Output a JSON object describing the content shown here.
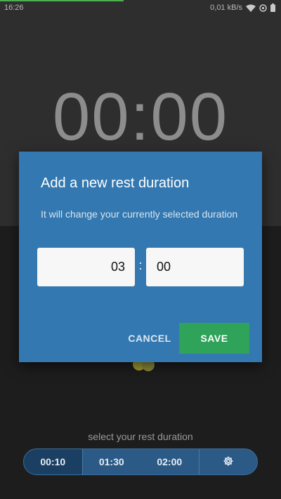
{
  "status_bar": {
    "time": "16:26",
    "network_speed": "0,01 kB/s",
    "icons": [
      "wifi-icon",
      "alarm-icon",
      "battery-icon"
    ]
  },
  "timer": {
    "display": "00:00"
  },
  "dialog": {
    "title": "Add a new rest duration",
    "message": "It will change your currently selected duration",
    "minutes_value": "03",
    "separator": ":",
    "seconds_value": "00",
    "cancel_label": "CANCEL",
    "save_label": "SAVE"
  },
  "rest_selector": {
    "label": "select your rest duration",
    "options": [
      {
        "label": "00:10",
        "selected": true
      },
      {
        "label": "01:30",
        "selected": false
      },
      {
        "label": "02:00",
        "selected": false
      }
    ],
    "settings_icon": "gear-icon"
  },
  "colors": {
    "dialog_background": "#3378b0",
    "save_button": "#2fa35a",
    "progress_accent": "#4caf50",
    "selector_background": "#2b5a86"
  }
}
